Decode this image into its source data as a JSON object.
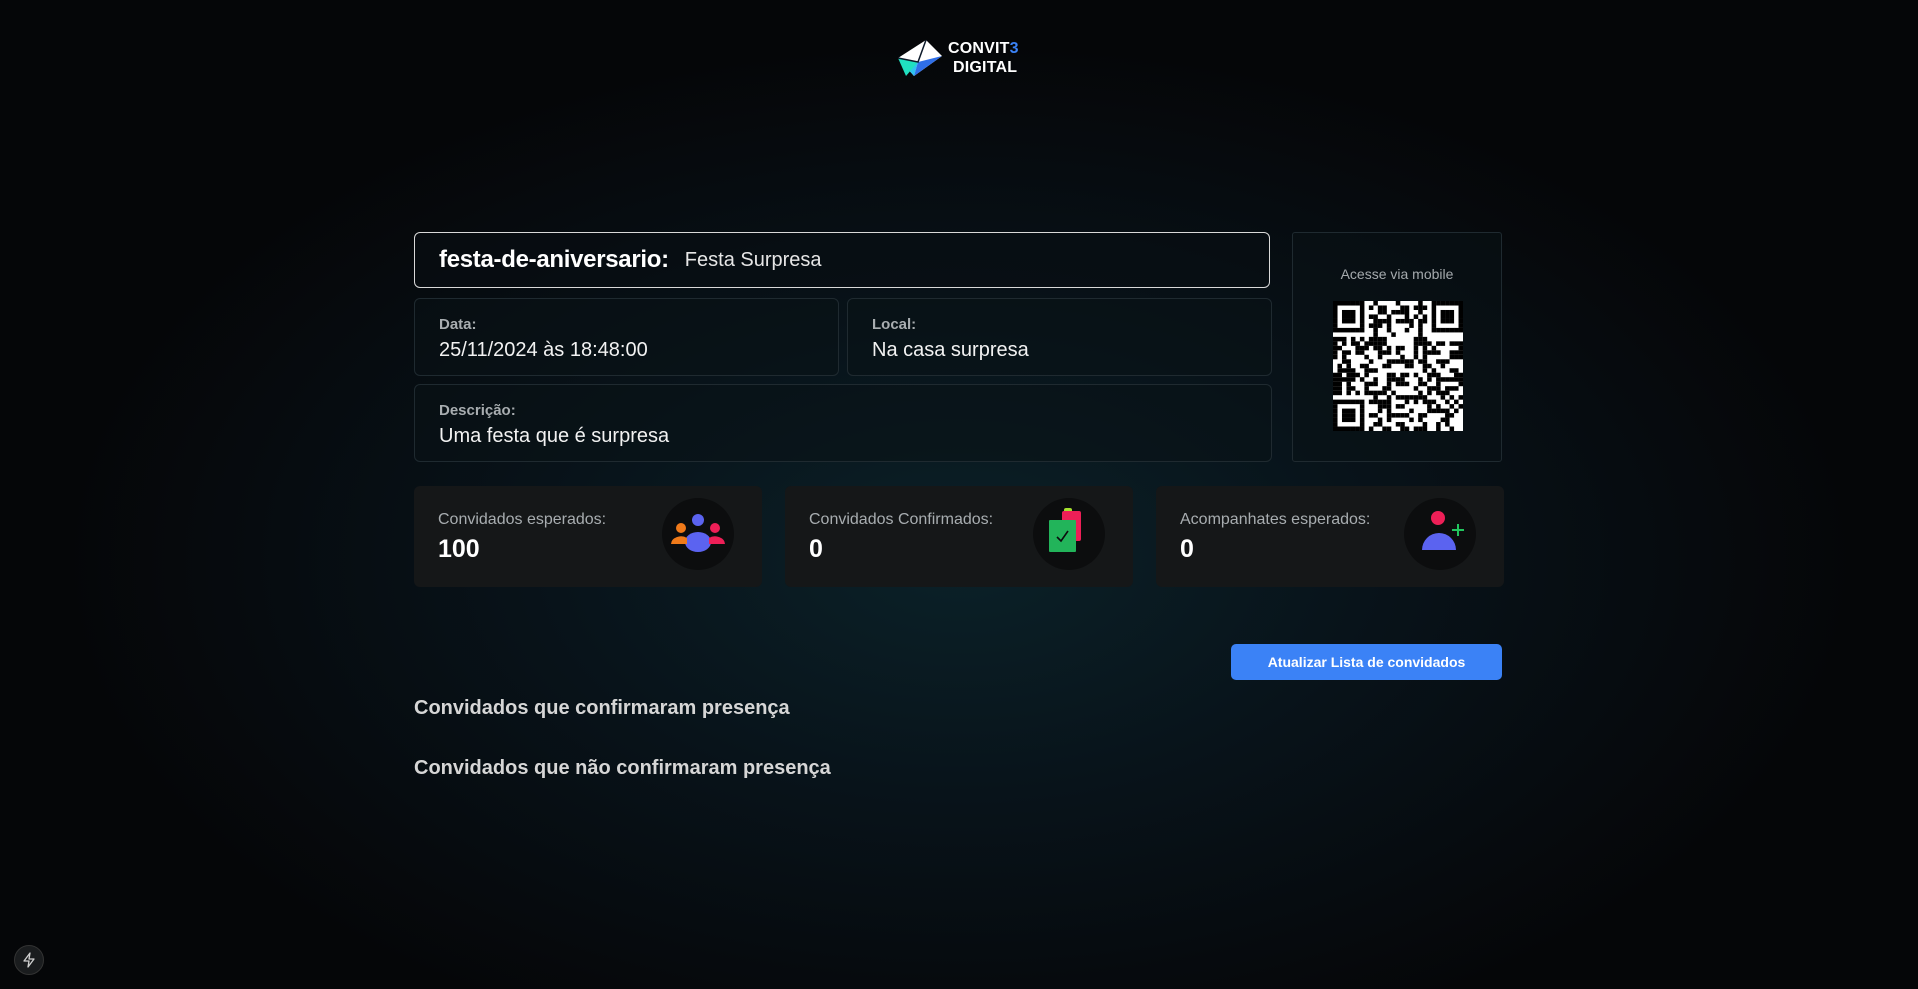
{
  "brand": {
    "line1_prefix": "CONVIT",
    "line1_accent": "3",
    "line2": "DIGITAL",
    "accent_color": "#3b82f6"
  },
  "event": {
    "slug": "festa-de-aniversario:",
    "name": "Festa Surpresa",
    "date_label": "Data:",
    "date_value": "25/11/2024 às 18:48:00",
    "location_label": "Local:",
    "location_value": "Na casa surpresa",
    "description_label": "Descrição:",
    "description_value": "Uma festa que é surpresa"
  },
  "qr": {
    "label": "Acesse via mobile"
  },
  "stats": [
    {
      "label": "Convidados esperados:",
      "value": "100",
      "icon": "group-icon"
    },
    {
      "label": "Convidados Confirmados:",
      "value": "0",
      "icon": "clipboard-check-icon"
    },
    {
      "label": "Acompanhates esperados:",
      "value": "0",
      "icon": "user-add-icon"
    }
  ],
  "actions": {
    "update_label": "Atualizar Lista de convidados"
  },
  "sections": {
    "confirmed_title": "Convidados que confirmaram presença",
    "unconfirmed_title": "Convidados que não confirmaram presença"
  },
  "colors": {
    "primary_button": "#3b82f6",
    "card_bg": "#151718"
  }
}
